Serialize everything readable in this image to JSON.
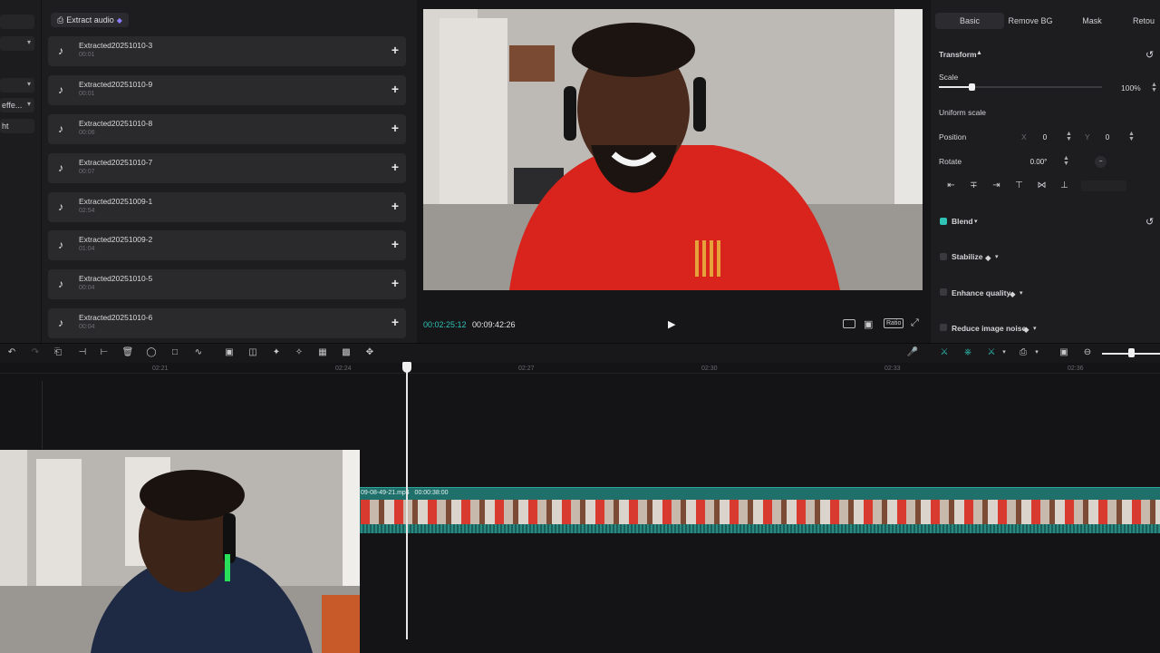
{
  "left_strip": {
    "items": [
      {
        "label": ""
      },
      {
        "label": ""
      },
      {
        "label": ""
      },
      {
        "label": "effe..."
      },
      {
        "label": "ht"
      }
    ]
  },
  "media": {
    "extract_label": "Extract audio",
    "items": [
      {
        "name": "Extracted20251010-3",
        "duration": "00:01"
      },
      {
        "name": "Extracted20251010-9",
        "duration": "00:01"
      },
      {
        "name": "Extracted20251010-8",
        "duration": "00:06"
      },
      {
        "name": "Extracted20251010-7",
        "duration": "00:07"
      },
      {
        "name": "Extracted20251009-1",
        "duration": "02:54"
      },
      {
        "name": "Extracted20251009-2",
        "duration": "01:04"
      },
      {
        "name": "Extracted20251010-5",
        "duration": "00:04"
      },
      {
        "name": "Extracted20251010-6",
        "duration": "00:04"
      }
    ]
  },
  "preview": {
    "current_time": "00:02:25:12",
    "total_time": "00:09:42:26",
    "ratio_label": "Ratio"
  },
  "inspector": {
    "tabs": [
      "Basic",
      "Remove BG",
      "Mask",
      "Retou"
    ],
    "transform_label": "Transform",
    "scale_label": "Scale",
    "scale_value": "100%",
    "scale_fraction": 0.2,
    "uniform_label": "Uniform scale",
    "position_label": "Position",
    "pos_x_label": "X",
    "pos_x": "0",
    "pos_y_label": "Y",
    "pos_y": "0",
    "rotate_label": "Rotate",
    "rotate_value": "0.00°",
    "blend_label": "Blend",
    "stabilize_label": "Stabilize",
    "enhance_label": "Enhance quality",
    "noise_label": "Reduce image noise"
  },
  "timeline": {
    "ticks": [
      "02:21",
      "02:24",
      "02:27",
      "02:30",
      "02:33",
      "02:36"
    ],
    "clip_name": "09-08-49-21.mp4",
    "clip_duration": "00:00:38:00"
  },
  "colors": {
    "accent": "#2fc2b5",
    "clip": "#1f6f6a",
    "premium": "#8d7cff"
  }
}
